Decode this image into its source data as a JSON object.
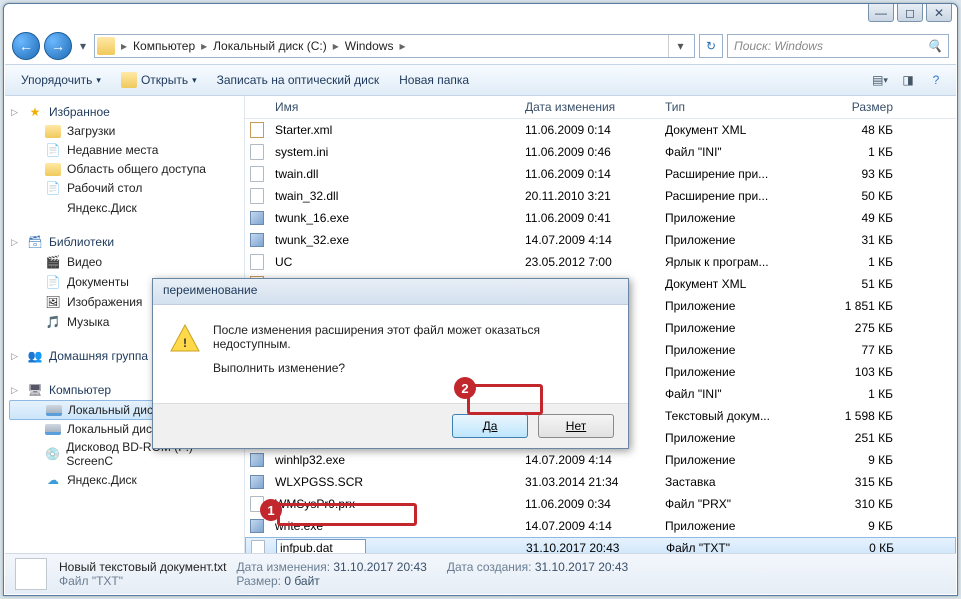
{
  "breadcrumb": {
    "root": "Компьютер",
    "drive": "Локальный диск (C:)",
    "folder": "Windows"
  },
  "search": {
    "placeholder": "Поиск: Windows"
  },
  "toolbar": {
    "organize": "Упорядочить",
    "open": "Открыть",
    "burn": "Записать на оптический диск",
    "new_folder": "Новая папка"
  },
  "nav": {
    "favorites": "Избранное",
    "fav_items": [
      "Загрузки",
      "Недавние места",
      "Область общего доступа",
      "Рабочий стол",
      "Яндекс.Диск"
    ],
    "libraries": "Библиотеки",
    "lib_items": [
      "Видео",
      "Документы",
      "Изображения",
      "Музыка"
    ],
    "homegroup": "Домашняя группа",
    "computer": "Компьютер",
    "comp_items": [
      "Локальный диск (C:)",
      "Локальный диск (D:)",
      "Дисковод BD-ROM (F:) ScreenC",
      "Яндекс.Диск"
    ]
  },
  "columns": {
    "name": "Имя",
    "date": "Дата изменения",
    "type": "Тип",
    "size": "Размер"
  },
  "files": [
    {
      "name": "Starter.xml",
      "date": "11.06.2009 0:14",
      "type": "Документ XML",
      "size": "48 КБ",
      "icon": "xml"
    },
    {
      "name": "system.ini",
      "date": "11.06.2009 0:46",
      "type": "Файл \"INI\"",
      "size": "1 КБ",
      "icon": "generic"
    },
    {
      "name": "twain.dll",
      "date": "11.06.2009 0:14",
      "type": "Расширение при...",
      "size": "93 КБ",
      "icon": "generic"
    },
    {
      "name": "twain_32.dll",
      "date": "20.11.2010 3:21",
      "type": "Расширение при...",
      "size": "50 КБ",
      "icon": "generic"
    },
    {
      "name": "twunk_16.exe",
      "date": "11.06.2009 0:41",
      "type": "Приложение",
      "size": "49 КБ",
      "icon": "exe"
    },
    {
      "name": "twunk_32.exe",
      "date": "14.07.2009 4:14",
      "type": "Приложение",
      "size": "31 КБ",
      "icon": "exe"
    },
    {
      "name": "UC",
      "date": "23.05.2012 7:00",
      "type": "Ярлык к програм...",
      "size": "1 КБ",
      "icon": "generic"
    },
    {
      "name": "Ultimate.xml",
      "date": "11.06.2009 0:14",
      "type": "Документ XML",
      "size": "51 КБ",
      "icon": "xml"
    },
    {
      "name": "",
      "date": "",
      "type": "Приложение",
      "size": "1 851 КБ",
      "icon": "exe"
    },
    {
      "name": "",
      "date": "",
      "type": "Приложение",
      "size": "275 КБ",
      "icon": ""
    },
    {
      "name": "",
      "date": "",
      "type": "Приложение",
      "size": "77 КБ",
      "icon": ""
    },
    {
      "name": "",
      "date": "",
      "type": "Приложение",
      "size": "103 КБ",
      "icon": ""
    },
    {
      "name": "",
      "date": "",
      "type": "Файл \"INI\"",
      "size": "1 КБ",
      "icon": ""
    },
    {
      "name": "",
      "date": "",
      "type": "Текстовый докум...",
      "size": "1 598 КБ",
      "icon": ""
    },
    {
      "name": "",
      "date": "",
      "type": "Приложение",
      "size": "251 КБ",
      "icon": ""
    },
    {
      "name": "winhlp32.exe",
      "date": "14.07.2009 4:14",
      "type": "Приложение",
      "size": "9 КБ",
      "icon": "exe"
    },
    {
      "name": "WLXPGSS.SCR",
      "date": "31.03.2014 21:34",
      "type": "Заставка",
      "size": "315 КБ",
      "icon": "exe"
    },
    {
      "name": "WMSysPr9.prx",
      "date": "11.06.2009 0:34",
      "type": "Файл \"PRX\"",
      "size": "310 КБ",
      "icon": "generic"
    },
    {
      "name": "write.exe",
      "date": "14.07.2009 4:14",
      "type": "Приложение",
      "size": "9 КБ",
      "icon": "exe"
    },
    {
      "name": "infpub.dat",
      "date": "31.10.2017 20:43",
      "type": "Файл \"TXT\"",
      "size": "0 КБ",
      "icon": "generic",
      "editing": true,
      "selected": true
    }
  ],
  "details": {
    "filename": "Новый текстовый документ.txt",
    "date_mod_label": "Дата изменения:",
    "date_mod": "31.10.2017 20:43",
    "date_cr_label": "Дата создания:",
    "date_cr": "31.10.2017 20:43",
    "type_label": "Файл \"TXT\"",
    "size_label": "Размер:",
    "size": "0 байт"
  },
  "dialog": {
    "title": "переименование",
    "line1": "После изменения расширения этот файл может оказаться недоступным.",
    "line2": "Выполнить изменение?",
    "yes": "Да",
    "no": "Нет"
  },
  "annotations": {
    "badge1": "1",
    "badge2": "2"
  }
}
